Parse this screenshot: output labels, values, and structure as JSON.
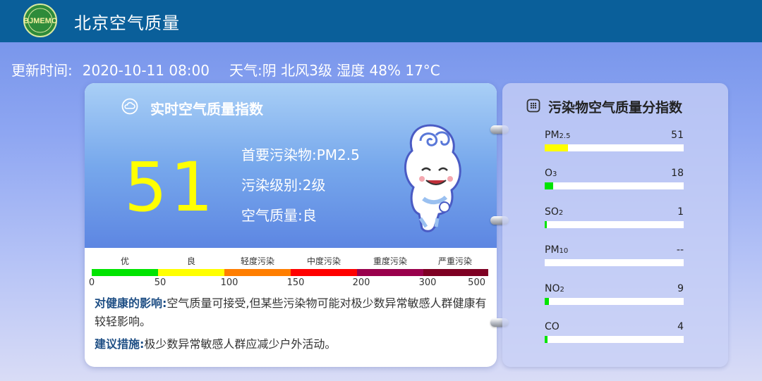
{
  "header": {
    "logo_text": "BJMEMC",
    "title": "北京空气质量"
  },
  "info": {
    "update_label": "更新时间:",
    "update_time": "2020-10-11 08:00",
    "weather_label": "天气:",
    "weather": "阴 北风3级 湿度 48% 17°C"
  },
  "aqi_card": {
    "title": "实时空气质量指数",
    "aqi": "51",
    "primary_pollutant": "首要污染物:PM2.5",
    "level": "污染级别:2级",
    "quality": "空气质量:良",
    "scale": [
      {
        "label": "优",
        "color": "#00e400"
      },
      {
        "label": "良",
        "color": "#ffff00"
      },
      {
        "label": "轻度污染",
        "color": "#ff7e00"
      },
      {
        "label": "中度污染",
        "color": "#ff0000"
      },
      {
        "label": "重度污染",
        "color": "#99004c"
      },
      {
        "label": "严重污染",
        "color": "#7e0023"
      }
    ],
    "ticks": [
      "0",
      "50",
      "100",
      "150",
      "200",
      "300",
      "500"
    ],
    "health_label": "对健康的影响:",
    "health_text": "空气质量可接受,但某些污染物可能对极少数异常敏感人群健康有较轻影响。",
    "advice_label": "建议措施:",
    "advice_text": "极少数异常敏感人群应减少户外活动。"
  },
  "pollutant_card": {
    "title": "污染物空气质量分指数",
    "items": [
      {
        "name": "PM",
        "sub": "2.5",
        "value": "51",
        "fill_fraction": 0.17,
        "color": "#ffff00"
      },
      {
        "name": "O",
        "sub": "3",
        "value": "18",
        "fill_fraction": 0.06,
        "color": "#00e400"
      },
      {
        "name": "SO",
        "sub": "2",
        "value": "1",
        "fill_fraction": 0.01,
        "color": "#00e400"
      },
      {
        "name": "PM",
        "sub": "10",
        "value": "--",
        "fill_fraction": 0,
        "color": "#00e400"
      },
      {
        "name": "NO",
        "sub": "2",
        "value": "9",
        "fill_fraction": 0.03,
        "color": "#00e400"
      },
      {
        "name": "CO",
        "sub": "",
        "value": "4",
        "fill_fraction": 0.02,
        "color": "#00e400"
      }
    ]
  }
}
